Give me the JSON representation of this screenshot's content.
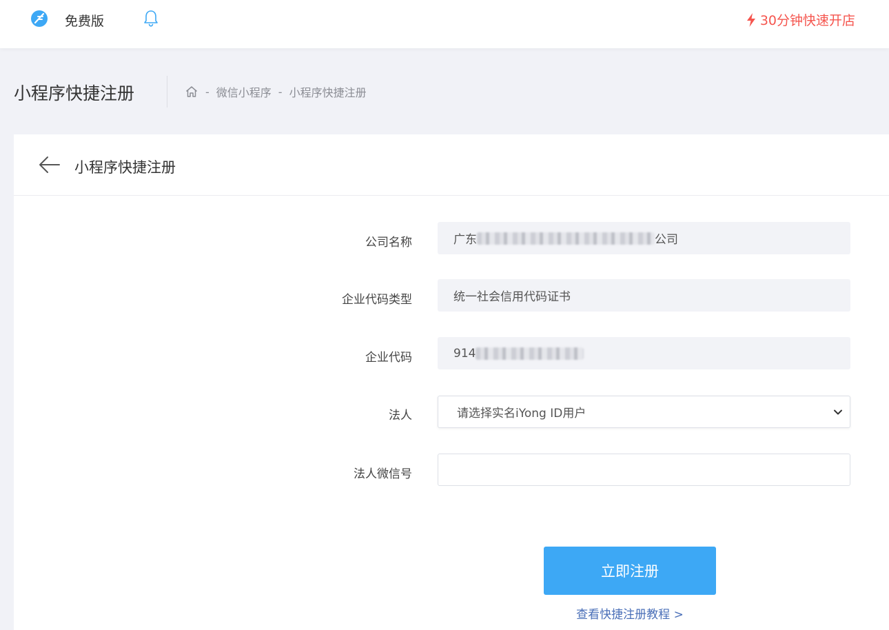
{
  "header": {
    "edition": "免费版",
    "quick_open": "30分钟快速开店",
    "accent_color": "#f5554e",
    "logo_color": "#3da8f5"
  },
  "page": {
    "title": "小程序快捷注册",
    "breadcrumb": [
      "微信小程序",
      "小程序快捷注册"
    ],
    "breadcrumb_separator": "-"
  },
  "card": {
    "title": "小程序快捷注册"
  },
  "form": {
    "company_name": {
      "label": "公司名称",
      "prefix": "广东",
      "suffix": "公司"
    },
    "code_type": {
      "label": "企业代码类型",
      "value": "统一社会信用代码证书"
    },
    "code": {
      "label": "企业代码",
      "prefix": "914"
    },
    "legal_person": {
      "label": "法人",
      "selected": "请选择实名iYong ID用户"
    },
    "legal_wechat": {
      "label": "法人微信号",
      "value": "",
      "placeholder": ""
    },
    "submit_label": "立即注册",
    "tutorial_link": "查看快捷注册教程 >"
  }
}
